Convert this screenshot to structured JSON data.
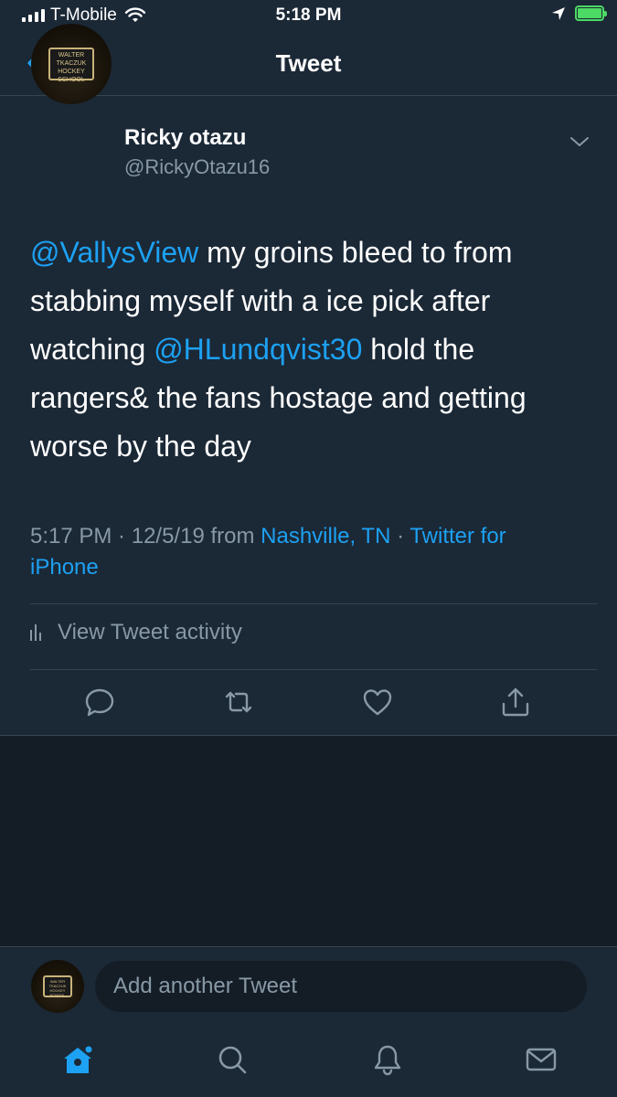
{
  "status_bar": {
    "carrier": "T-Mobile",
    "time": "5:18 PM",
    "battery_state": "charging"
  },
  "header": {
    "title": "Tweet",
    "back_icon": "chevron-left-icon"
  },
  "tweet": {
    "author": {
      "display_name": "Ricky otazu",
      "handle": "@RickyOtazu16",
      "avatar_text": "WALTER TKACZUK HOCKEY SCHOOL"
    },
    "text_parts": {
      "mention1": "@VallysView",
      "text1": " my groins bleed to from stabbing myself with a ice pick after watching ",
      "mention2": "@HLundqvist30",
      "text2": " hold the rangers& the fans hostage and getting worse by the day"
    },
    "meta": {
      "time": "5:17 PM",
      "sep1": " · ",
      "date": "12/5/19",
      "from": " from ",
      "location": "Nashville, TN",
      "sep2": " · ",
      "source": "Twitter for iPhone"
    },
    "activity_label": "View Tweet activity",
    "actions": [
      "reply-icon",
      "retweet-icon",
      "like-icon",
      "share-icon"
    ]
  },
  "compose": {
    "placeholder": "Add another Tweet"
  },
  "tab_bar": {
    "items": [
      "home-icon",
      "search-icon",
      "notifications-icon",
      "messages-icon"
    ],
    "active": "home-icon"
  },
  "colors": {
    "background": "#141d26",
    "card": "#1b2836",
    "accent": "#1da1f2",
    "muted": "#8899a6",
    "divider": "#38444d"
  }
}
